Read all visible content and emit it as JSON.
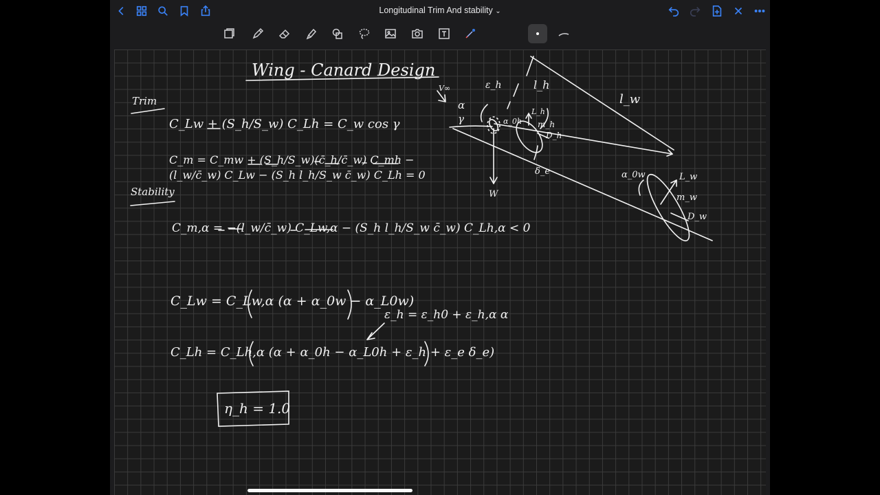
{
  "document": {
    "title": "Longitudinal Trim And stability",
    "title_chevron": "⌄"
  },
  "nav": {
    "left_icons": [
      "chevron-left-icon",
      "grid-icon",
      "search-icon",
      "bookmark-icon",
      "share-icon"
    ],
    "right_icons": [
      "undo-icon",
      "redo-icon",
      "add-page-icon",
      "close-icon",
      "more-icon"
    ]
  },
  "toolbar": {
    "tools": [
      "reader-icon",
      "pen-icon",
      "eraser-icon",
      "highlighter-icon",
      "shapes-icon",
      "lasso-icon",
      "image-icon",
      "camera-icon",
      "text-icon",
      "laser-pointer-icon"
    ],
    "selected_tool": "pen",
    "pen_colors": [
      "#ffffff"
    ],
    "accent_color": "#3a82f7"
  },
  "notes": {
    "heading": "Wing - Canard Design",
    "trim_label": "Trim",
    "trim_eq1": "C_Lw + (S_h/S_w) C_Lh = C_w cos γ",
    "trim_eq2": "C_m = C_mw + (S_h/S_w)(c̄_h/c̄_w) C_mh − (l_w/c̄_w) C_Lw − (S_h l_h/S_w c̄_w) C_Lh = 0",
    "stability_label": "Stability",
    "stability_eq": "C_m,α = −(l_w/c̄_w) C_Lw,α − (S_h l_h/S_w c̄_w) C_Lh,α < 0",
    "clw_eq": "C_Lw = C_Lw,α (α + α_0w − α_L0w)",
    "epsilon_eq": "ε_h = ε_h0 + ε_h,α α",
    "clh_eq": "C_Lh = C_Lh,α (α + α_0h − α_L0h + ε_h + ε_e δ_e)",
    "eta_eq": "η_h = 1.0",
    "diagram_labels": [
      "ε_h",
      "l_h",
      "l_w",
      "α",
      "γ",
      "α_0h",
      "L_h",
      "m_h",
      "D_h",
      "δ_e",
      "W",
      "α_0w",
      "L_w",
      "m_w",
      "D_w",
      "V∞"
    ]
  }
}
